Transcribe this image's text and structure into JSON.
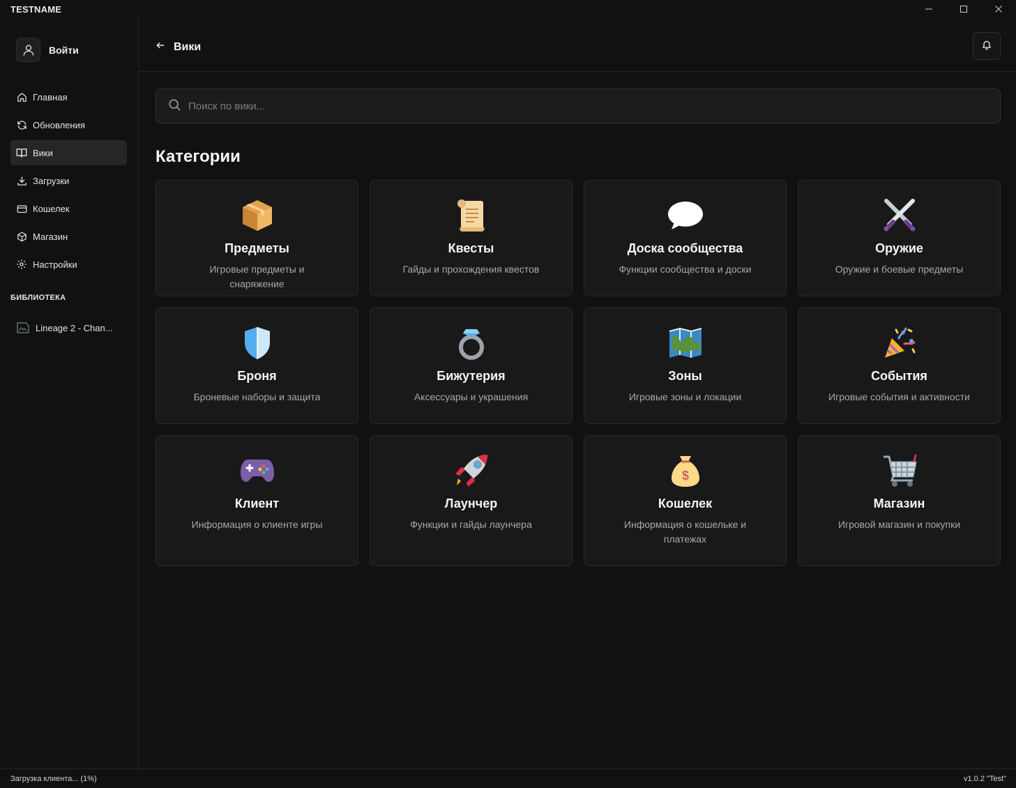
{
  "app": {
    "title": "TESTNAME"
  },
  "sidebar": {
    "login_label": "Войти",
    "nav": [
      {
        "label": "Главная",
        "icon": "home-icon"
      },
      {
        "label": "Обновления",
        "icon": "refresh-icon"
      },
      {
        "label": "Вики",
        "icon": "book-icon",
        "active": true
      },
      {
        "label": "Загрузки",
        "icon": "download-icon"
      },
      {
        "label": "Кошелек",
        "icon": "wallet-icon"
      },
      {
        "label": "Магазин",
        "icon": "box-icon"
      },
      {
        "label": "Настройки",
        "icon": "gear-icon"
      }
    ],
    "library_header": "БИБЛИОТЕКА",
    "library_items": [
      {
        "label": "Lineage 2 - Chan...",
        "thumb_alt": "L"
      }
    ]
  },
  "header": {
    "back_label": "Вики"
  },
  "search": {
    "placeholder": "Поиск по вики..."
  },
  "main": {
    "section_title": "Категории",
    "categories": [
      {
        "title": "Предметы",
        "desc": "Игровые предметы и снаряжение",
        "icon": "package-icon"
      },
      {
        "title": "Квесты",
        "desc": "Гайды и прохождения квестов",
        "icon": "scroll-icon"
      },
      {
        "title": "Доска сообщества",
        "desc": "Функции сообщества и доски",
        "icon": "speech-bubble-icon"
      },
      {
        "title": "Оружие",
        "desc": "Оружие и боевые предметы",
        "icon": "crossed-swords-icon"
      },
      {
        "title": "Броня",
        "desc": "Броневые наборы и защита",
        "icon": "shield-icon"
      },
      {
        "title": "Бижутерия",
        "desc": "Аксессуары и украшения",
        "icon": "ring-icon"
      },
      {
        "title": "Зоны",
        "desc": "Игровые зоны и локации",
        "icon": "map-icon"
      },
      {
        "title": "События",
        "desc": "Игровые события и активности",
        "icon": "party-popper-icon"
      },
      {
        "title": "Клиент",
        "desc": "Информация о клиенте игры",
        "icon": "gamepad-icon"
      },
      {
        "title": "Лаунчер",
        "desc": "Функции и гайды лаунчера",
        "icon": "rocket-icon"
      },
      {
        "title": "Кошелек",
        "desc": "Информация о кошельке и платежах",
        "icon": "money-bag-icon"
      },
      {
        "title": "Магазин",
        "desc": "Игровой магазин и покупки",
        "icon": "shopping-cart-icon"
      }
    ]
  },
  "status": {
    "left": "Загрузка клиента... (1%)",
    "right": "v1.0.2 \"Test\""
  }
}
